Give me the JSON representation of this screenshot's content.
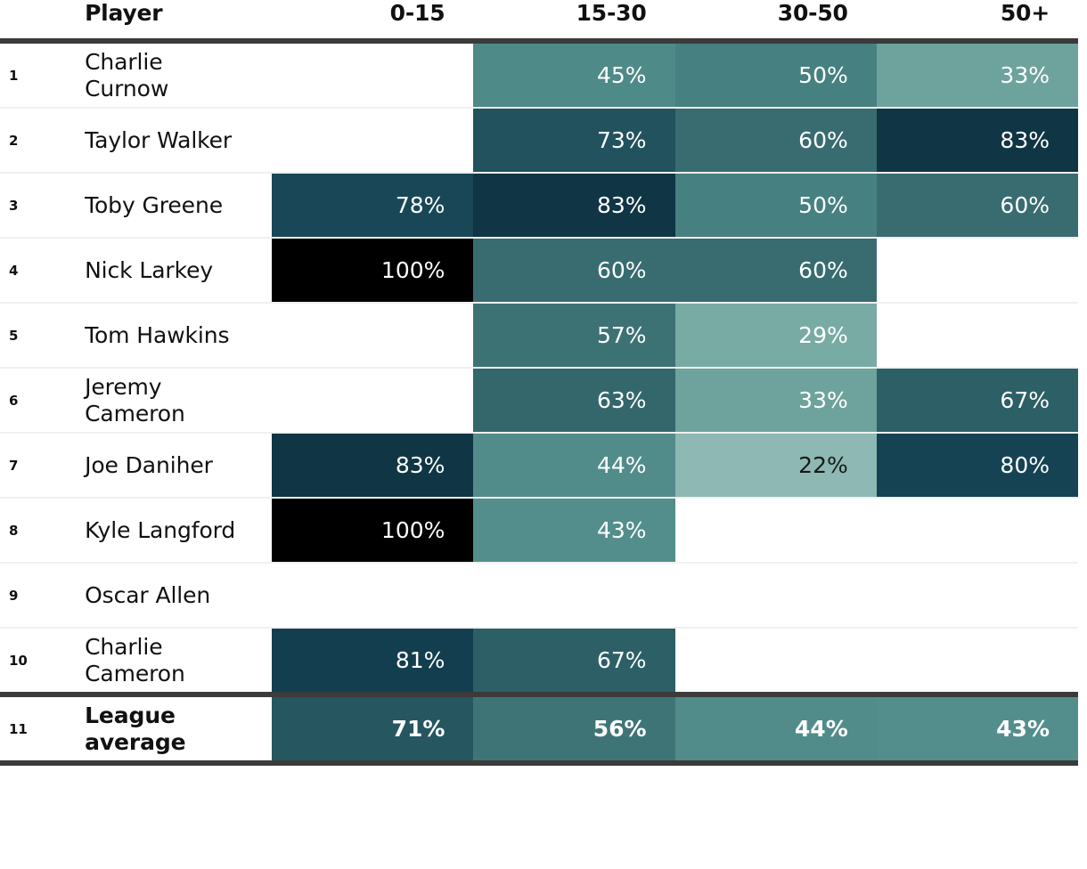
{
  "table": {
    "columns": [
      {
        "key": "rank",
        "label": ""
      },
      {
        "key": "player",
        "label": "Player"
      },
      {
        "key": "b0_15",
        "label": "0-15"
      },
      {
        "key": "b15_30",
        "label": "15-30"
      },
      {
        "key": "b30_50",
        "label": "30-50"
      },
      {
        "key": "b50p",
        "label": "50+"
      }
    ],
    "rows": [
      {
        "rank": "1",
        "player": "Charlie Curnow",
        "values": [
          "",
          "45%",
          "50%",
          "33%"
        ]
      },
      {
        "rank": "2",
        "player": "Taylor Walker",
        "values": [
          "",
          "73%",
          "60%",
          "83%"
        ]
      },
      {
        "rank": "3",
        "player": "Toby Greene",
        "values": [
          "78%",
          "83%",
          "50%",
          "60%"
        ]
      },
      {
        "rank": "4",
        "player": "Nick Larkey",
        "values": [
          "100%",
          "60%",
          "60%",
          ""
        ]
      },
      {
        "rank": "5",
        "player": "Tom Hawkins",
        "values": [
          "",
          "57%",
          "29%",
          ""
        ]
      },
      {
        "rank": "6",
        "player": "Jeremy Cameron",
        "values": [
          "",
          "63%",
          "33%",
          "67%"
        ]
      },
      {
        "rank": "7",
        "player": "Joe Daniher",
        "values": [
          "83%",
          "44%",
          "22%",
          "80%"
        ]
      },
      {
        "rank": "8",
        "player": "Kyle Langford",
        "values": [
          "100%",
          "43%",
          "",
          ""
        ]
      },
      {
        "rank": "9",
        "player": "Oscar Allen",
        "values": [
          "",
          "",
          "",
          ""
        ]
      },
      {
        "rank": "10",
        "player": "Charlie Cameron",
        "values": [
          "81%",
          "67%",
          "",
          ""
        ]
      },
      {
        "rank": "11",
        "player": "League average",
        "values": [
          "71%",
          "56%",
          "44%",
          "43%"
        ],
        "emphasis": true
      }
    ]
  },
  "chart_data": {
    "type": "heatmap",
    "title": "",
    "xlabel": "",
    "ylabel": "",
    "categories": [
      "0-15",
      "15-30",
      "30-50",
      "50+"
    ],
    "row_labels": [
      "Charlie Curnow",
      "Taylor Walker",
      "Toby Greene",
      "Nick Larkey",
      "Tom Hawkins",
      "Jeremy Cameron",
      "Joe Daniher",
      "Kyle Langford",
      "Oscar Allen",
      "Charlie Cameron",
      "League average"
    ],
    "values": [
      [
        null,
        45,
        50,
        33
      ],
      [
        null,
        73,
        60,
        83
      ],
      [
        78,
        83,
        50,
        60
      ],
      [
        100,
        60,
        60,
        null
      ],
      [
        null,
        57,
        29,
        null
      ],
      [
        null,
        63,
        33,
        67
      ],
      [
        83,
        44,
        22,
        80
      ],
      [
        100,
        43,
        null,
        null
      ],
      [
        null,
        null,
        null,
        null
      ],
      [
        81,
        67,
        null,
        null
      ],
      [
        71,
        56,
        44,
        43
      ]
    ],
    "value_unit": "%",
    "zlim": [
      22,
      100
    ],
    "colorscale": [
      {
        "stop": 22,
        "color": "#8db8b3"
      },
      {
        "stop": 33,
        "color": "#6ea39d"
      },
      {
        "stop": 45,
        "color": "#4e8a88"
      },
      {
        "stop": 56,
        "color": "#3f7476"
      },
      {
        "stop": 67,
        "color": "#2d5f66"
      },
      {
        "stop": 80,
        "color": "#154354"
      },
      {
        "stop": 83,
        "color": "#103544"
      },
      {
        "stop": 100,
        "color": "#000000"
      }
    ],
    "grid": false,
    "legend": "none"
  },
  "style": {
    "rule_color": "#3b3b3b",
    "row_separator_color": "#f0f0f0",
    "text_color": "#111111",
    "cell_text_light": "#ffffff",
    "cell_text_dark": "#1a1a1a",
    "background": "#ffffff"
  }
}
